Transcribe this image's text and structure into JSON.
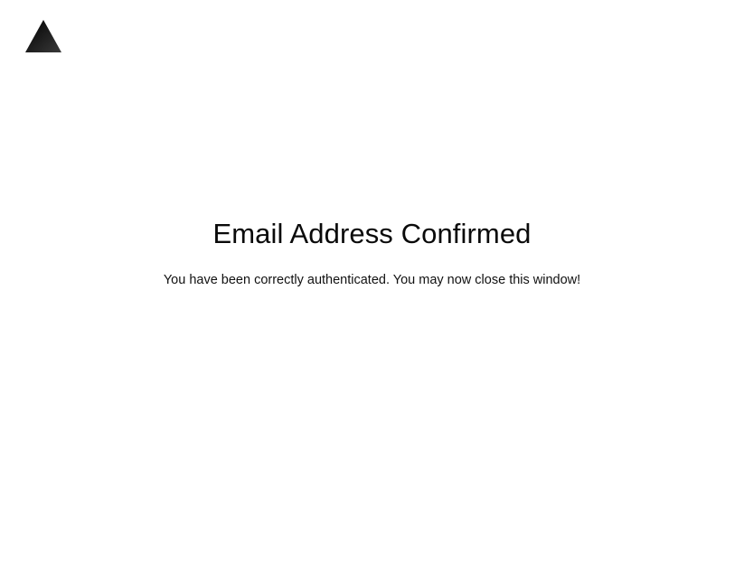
{
  "brand": {
    "logo_icon": "triangle-logo-icon",
    "logo_colors": {
      "start": "#000000",
      "end": "#3a3a3a"
    }
  },
  "main": {
    "title": "Email Address Confirmed",
    "message": "You have been correctly authenticated. You may now close this window!"
  }
}
